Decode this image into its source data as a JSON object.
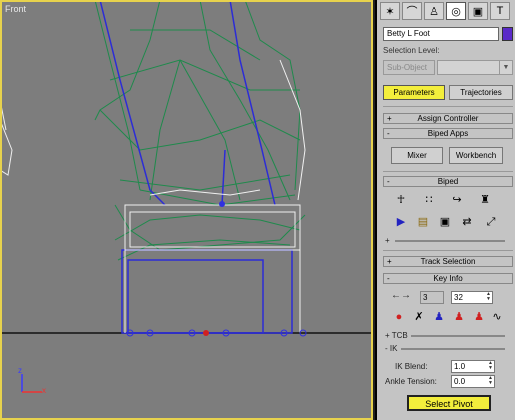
{
  "viewport": {
    "label": "Front"
  },
  "axis": {
    "z": "z",
    "x": "x"
  },
  "panel": {
    "object_name": "Betty L Foot",
    "selection_level_label": "Selection Level:",
    "subobject_label": "Sub-Object",
    "tab_parameters": "Parameters",
    "tab_trajectories": "Trajectories",
    "rollouts": {
      "assign_controller": {
        "sign": "+",
        "label": "Assign Controller"
      },
      "biped_apps": {
        "sign": "-",
        "label": "Biped Apps"
      },
      "biped": {
        "sign": "-",
        "label": "Biped"
      },
      "track_selection": {
        "sign": "+",
        "label": "Track Selection"
      },
      "key_info": {
        "sign": "-",
        "label": "Key Info"
      }
    },
    "biped_apps": {
      "mixer": "Mixer",
      "workbench": "Workbench"
    },
    "key_info": {
      "nav_arrows": "←→",
      "key_number": "3",
      "frame": "32",
      "tcb": "+ TCB",
      "ik": "- IK",
      "ik_blend_label": "IK Blend:",
      "ik_blend_value": "1.0",
      "ankle_tension_label": "Ankle Tension:",
      "ankle_tension_value": "0.0",
      "select_pivot": "Select Pivot"
    }
  },
  "colors": {
    "viewport_bg": "#7d7d7d",
    "highlight": "#f3ee3c",
    "swatch": "#5a2ac8",
    "viewport_border": "#e7d24d"
  }
}
